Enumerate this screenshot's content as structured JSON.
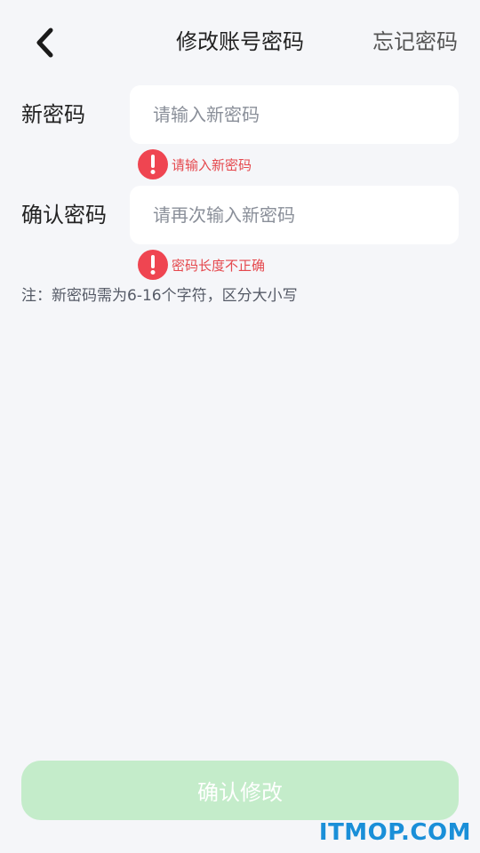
{
  "header": {
    "title": "修改账号密码",
    "forgot_label": "忘记密码"
  },
  "form": {
    "new_password": {
      "label": "新密码",
      "placeholder": "请输入新密码",
      "value": "",
      "error": "请输入新密码"
    },
    "confirm_password": {
      "label": "确认密码",
      "placeholder": "请再次输入新密码",
      "value": "",
      "error": "密码长度不正确"
    },
    "note": "注：新密码需为6-16个字符，区分大小写"
  },
  "footer": {
    "confirm_label": "确认修改"
  },
  "watermark": "ITMOP.COM",
  "colors": {
    "background": "#f5f6f9",
    "error": "#ef4551",
    "button_disabled": "#c4ecca",
    "watermark": "#1a8fd8"
  },
  "icons": {
    "back": "chevron-left-icon",
    "error": "exclamation-circle-icon"
  }
}
